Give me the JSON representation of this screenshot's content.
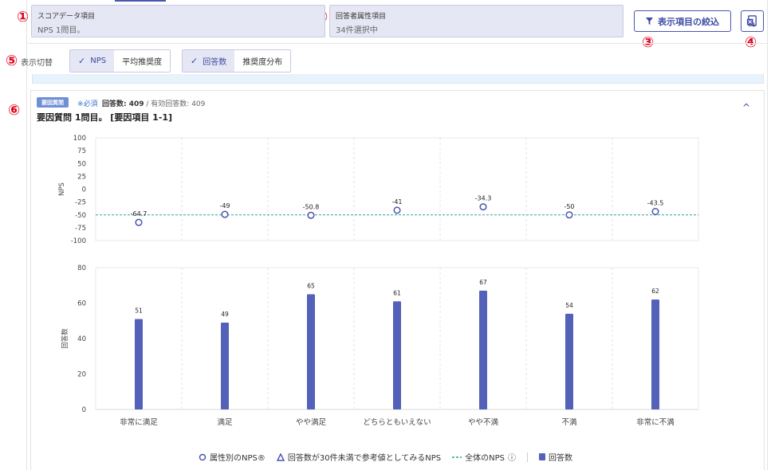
{
  "markers": [
    "①",
    "②",
    "③",
    "④",
    "⑤",
    "⑥"
  ],
  "score_box": {
    "label": "スコアデータ項目",
    "value": "NPS 1問目。"
  },
  "attr_box": {
    "label": "回答者属性項目",
    "value": "34件選択中"
  },
  "filter_button": {
    "label": "表示項目の絞込",
    "icon": "filter-icon"
  },
  "export_button": {
    "icon": "excel-export-icon"
  },
  "toggle": {
    "label": "表示切替",
    "group1": [
      {
        "label": "NPS",
        "selected": true
      },
      {
        "label": "平均推奨度",
        "selected": false
      }
    ],
    "group2": [
      {
        "label": "回答数",
        "selected": true
      },
      {
        "label": "推奨度分布",
        "selected": false
      }
    ],
    "check": "✓"
  },
  "question": {
    "badge": "要因質問",
    "required": "※必須",
    "count_label": "回答数: 409",
    "valid_label": "/ 有効回答数: 409",
    "title": "要因質問 1問目。 [要因項目 1-1]",
    "collapse_icon": "^"
  },
  "colors": {
    "accent": "#4a56b0",
    "bar": "#5361b9",
    "marker": "#e0001a",
    "overall_line": "#2aa39a"
  },
  "chart_data": [
    {
      "type": "scatter",
      "ylabel": "NPS",
      "ylim": [
        -100,
        100
      ],
      "yticks": [
        100,
        75,
        50,
        25,
        0,
        -25,
        -50,
        -75,
        -100
      ],
      "categories": [
        "非常に満足",
        "満足",
        "やや満足",
        "どちらともいえない",
        "やや不満",
        "不満",
        "非常に不満"
      ],
      "values": [
        -64.7,
        -49,
        -50.8,
        -41,
        -34.3,
        -50,
        -43.5
      ],
      "labels": [
        "-64.7",
        "-49",
        "-50.8",
        "-41",
        "-34.3",
        "-50",
        "-43.5"
      ],
      "overall_nps": -50
    },
    {
      "type": "bar",
      "ylabel": "回答数",
      "ylim": [
        0,
        80
      ],
      "yticks": [
        80,
        60,
        40,
        20,
        0
      ],
      "categories": [
        "非常に満足",
        "満足",
        "やや満足",
        "どちらともいえない",
        "やや不満",
        "不満",
        "非常に不満"
      ],
      "values": [
        51,
        49,
        65,
        61,
        67,
        54,
        62
      ]
    }
  ],
  "legend": {
    "nps_by_attr": "属性別のNPS®",
    "ref_value": "回答数が30件未満で参考値としてみるNPS",
    "overall_nps": "全体のNPS",
    "count": "回答数",
    "info_icon": "ⓘ"
  }
}
